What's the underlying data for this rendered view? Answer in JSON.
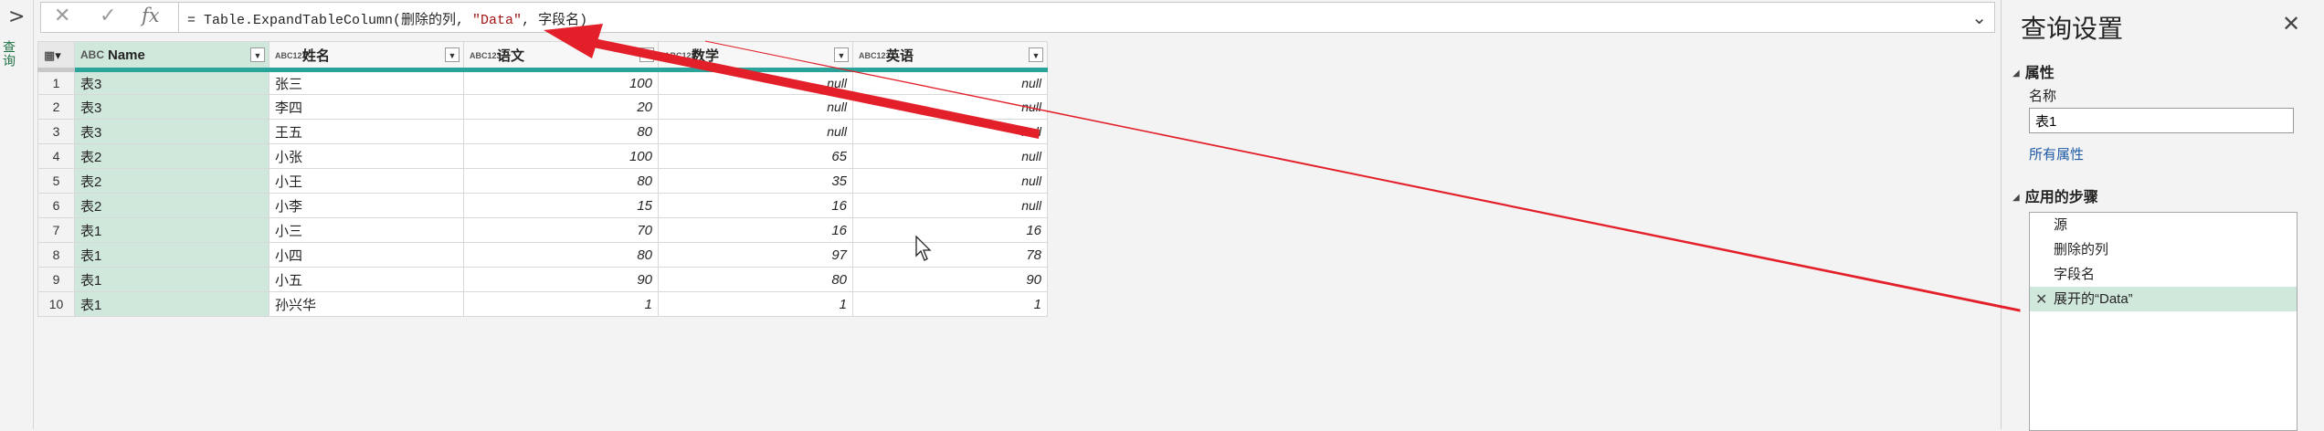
{
  "left_pane": {
    "chevron": ">",
    "label": "查询"
  },
  "formula": {
    "prefix": "= Table.ExpandTableColumn(删除的列, ",
    "string_part": "\"Data\"",
    "suffix": ", 字段名)"
  },
  "grid": {
    "columns": [
      {
        "type": "ABC",
        "name": "Name"
      },
      {
        "type": "ABC123",
        "name": "姓名"
      },
      {
        "type": "ABC123",
        "name": "语文"
      },
      {
        "type": "ABC123",
        "name": "数学"
      },
      {
        "type": "ABC123",
        "name": "英语"
      }
    ],
    "rows": [
      [
        "1",
        "表3",
        "张三",
        "100",
        "null",
        "null"
      ],
      [
        "2",
        "表3",
        "李四",
        "20",
        "null",
        "null"
      ],
      [
        "3",
        "表3",
        "王五",
        "80",
        "null",
        "null"
      ],
      [
        "4",
        "表2",
        "小张",
        "100",
        "65",
        "null"
      ],
      [
        "5",
        "表2",
        "小王",
        "80",
        "35",
        "null"
      ],
      [
        "6",
        "表2",
        "小李",
        "15",
        "16",
        "null"
      ],
      [
        "7",
        "表1",
        "小三",
        "70",
        "16",
        "16"
      ],
      [
        "8",
        "表1",
        "小四",
        "80",
        "97",
        "78"
      ],
      [
        "9",
        "表1",
        "小五",
        "90",
        "80",
        "90"
      ],
      [
        "10",
        "表1",
        "孙兴华",
        "1",
        "1",
        "1"
      ]
    ]
  },
  "settings": {
    "title": "查询设置",
    "close": "✕",
    "properties_header": "属性",
    "name_label": "名称",
    "name_value": "表1",
    "all_properties_link": "所有属性",
    "steps_header": "应用的步骤",
    "steps": [
      "源",
      "删除的列",
      "字段名",
      "展开的“Data”"
    ],
    "active_step_index": 3
  },
  "colors": {
    "accent_green": "#217346",
    "selected_column": "#cfe8db",
    "annotation_arrow": "#e3202a",
    "teal_quality_bar": "#2aa39a"
  }
}
